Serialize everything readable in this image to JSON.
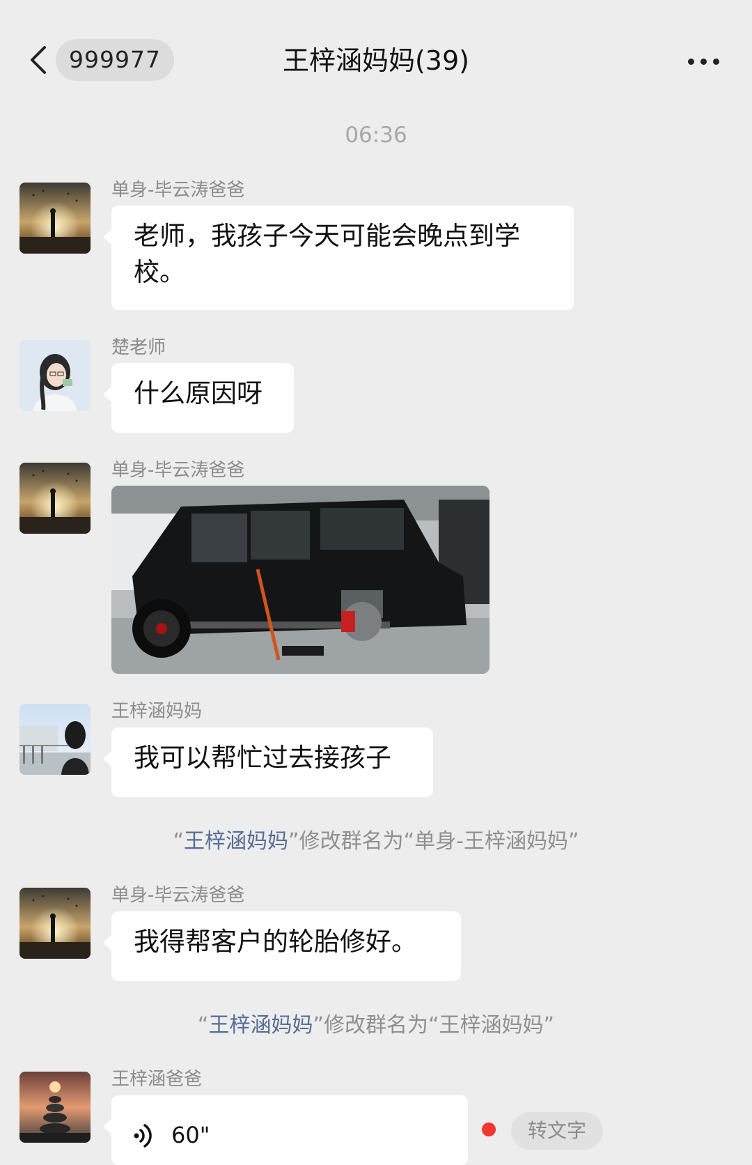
{
  "header": {
    "unread_count": "999977",
    "title": "王梓涵妈妈(39)",
    "icons": [
      "back-chevron-icon",
      "more-dots-icon"
    ]
  },
  "timestamp": "06:36",
  "messages": [
    {
      "sender": "单身-毕云涛爸爸",
      "text": "老师，我孩子今天可能会晚点到学校。"
    },
    {
      "sender": "楚老师",
      "text": "什么原因呀"
    },
    {
      "sender": "单身-毕云涛爸爸",
      "image": "black-suv-on-jack-with-wheel-removed"
    },
    {
      "sender": "王梓涵妈妈",
      "text": "我可以帮忙过去接孩子"
    },
    {
      "sender": "单身-毕云涛爸爸",
      "text": "我得帮客户的轮胎修好。"
    },
    {
      "sender": "王梓涵爸爸",
      "voice_duration": "60\""
    }
  ],
  "system_messages": [
    {
      "open": "“",
      "actor": "王梓涵妈妈",
      "rest": "”修改群名为“单身-王梓涵妈妈”"
    },
    {
      "open": "“",
      "actor": "王梓涵妈妈",
      "rest": "”修改群名为“王梓涵妈妈”"
    }
  ],
  "voice_actions": {
    "to_text_label": "转文字"
  },
  "colors": {
    "background": "#ededed",
    "bubble": "#ffffff",
    "link_name": "#576b95",
    "unread_dot": "#f43530"
  }
}
